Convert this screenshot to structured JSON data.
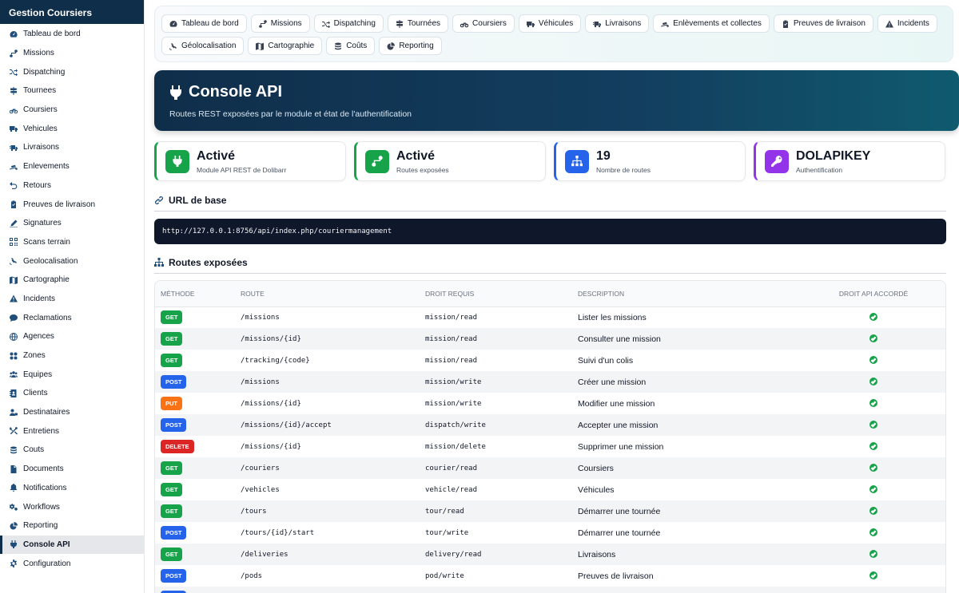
{
  "sidebar": {
    "title": "Gestion Coursiers",
    "items": [
      {
        "label": "Tableau de bord",
        "icon": "dashboard-icon"
      },
      {
        "label": "Missions",
        "icon": "route-icon"
      },
      {
        "label": "Dispatching",
        "icon": "shuffle-icon"
      },
      {
        "label": "Tournees",
        "icon": "signpost-icon"
      },
      {
        "label": "Coursiers",
        "icon": "bicycle-icon"
      },
      {
        "label": "Vehicules",
        "icon": "truck-icon"
      },
      {
        "label": "Livraisons",
        "icon": "truck-fast-icon"
      },
      {
        "label": "Enlevements",
        "icon": "dolly-icon"
      },
      {
        "label": "Retours",
        "icon": "undo-icon"
      },
      {
        "label": "Preuves de livraison",
        "icon": "clipboard-check-icon"
      },
      {
        "label": "Signatures",
        "icon": "signature-icon"
      },
      {
        "label": "Scans terrain",
        "icon": "qrcode-icon"
      },
      {
        "label": "Geolocalisation",
        "icon": "satellite-icon"
      },
      {
        "label": "Cartographie",
        "icon": "map-icon"
      },
      {
        "label": "Incidents",
        "icon": "warning-icon"
      },
      {
        "label": "Reclamations",
        "icon": "comment-icon"
      },
      {
        "label": "Agences",
        "icon": "globe-icon"
      },
      {
        "label": "Zones",
        "icon": "zones-icon"
      },
      {
        "label": "Equipes",
        "icon": "users-icon"
      },
      {
        "label": "Clients",
        "icon": "address-book-icon"
      },
      {
        "label": "Destinataires",
        "icon": "user-tag-icon"
      },
      {
        "label": "Entretiens",
        "icon": "tools-icon"
      },
      {
        "label": "Couts",
        "icon": "coins-icon"
      },
      {
        "label": "Documents",
        "icon": "file-icon"
      },
      {
        "label": "Notifications",
        "icon": "bell-icon"
      },
      {
        "label": "Workflows",
        "icon": "cogs-icon"
      },
      {
        "label": "Reporting",
        "icon": "chart-pie-icon"
      },
      {
        "label": "Console API",
        "icon": "plug-icon",
        "active": true
      },
      {
        "label": "Configuration",
        "icon": "gear-icon"
      }
    ]
  },
  "navbar": {
    "row1": [
      {
        "label": "Tableau de bord",
        "icon": "dashboard-icon"
      },
      {
        "label": "Missions",
        "icon": "route-icon"
      },
      {
        "label": "Dispatching",
        "icon": "shuffle-icon"
      },
      {
        "label": "Tournées",
        "icon": "signpost-icon"
      },
      {
        "label": "Coursiers",
        "icon": "bicycle-icon"
      },
      {
        "label": "Véhicules",
        "icon": "truck-icon"
      },
      {
        "label": "Livraisons",
        "icon": "truck-fast-icon"
      },
      {
        "label": "Enlèvements et collectes",
        "icon": "dolly-icon"
      },
      {
        "label": "Preuves de livraison",
        "icon": "clipboard-check-icon"
      },
      {
        "label": "Incidents",
        "icon": "warning-icon"
      }
    ],
    "row2": [
      {
        "label": "Géolocalisation",
        "icon": "satellite-icon"
      },
      {
        "label": "Cartographie",
        "icon": "map-icon"
      },
      {
        "label": "Coûts",
        "icon": "coins-icon"
      },
      {
        "label": "Reporting",
        "icon": "chart-pie-icon"
      }
    ]
  },
  "header": {
    "title": "Console API",
    "subtitle": "Routes REST exposées par le module et état de l'authentification"
  },
  "stats": [
    {
      "value": "Activé",
      "label": "Module API REST de Dolibarr",
      "color": "#16a34a",
      "icon": "plug-icon"
    },
    {
      "value": "Activé",
      "label": "Routes exposées",
      "color": "#16a34a",
      "icon": "route-icon"
    },
    {
      "value": "19",
      "label": "Nombre de routes",
      "color": "#2563eb",
      "icon": "sitemap-icon"
    },
    {
      "value": "DOLAPIKEY",
      "label": "Authentification",
      "color": "#9333ea",
      "icon": "key-icon"
    }
  ],
  "base_url": {
    "title": "URL de base",
    "value": "http://127.0.0.1:8756/api/index.php/couriermanagement"
  },
  "routes": {
    "title": "Routes exposées",
    "columns": [
      "Méthode",
      "Route",
      "Droit requis",
      "Description",
      "Droit API accordé"
    ],
    "rows": [
      {
        "method": "GET",
        "route": "/missions",
        "right": "mission/read",
        "description": "Lister les missions",
        "granted": true
      },
      {
        "method": "GET",
        "route": "/missions/{id}",
        "right": "mission/read",
        "description": "Consulter une mission",
        "granted": true
      },
      {
        "method": "GET",
        "route": "/tracking/{code}",
        "right": "mission/read",
        "description": "Suivi d'un colis",
        "granted": true
      },
      {
        "method": "POST",
        "route": "/missions",
        "right": "mission/write",
        "description": "Créer une mission",
        "granted": true
      },
      {
        "method": "PUT",
        "route": "/missions/{id}",
        "right": "mission/write",
        "description": "Modifier une mission",
        "granted": true
      },
      {
        "method": "POST",
        "route": "/missions/{id}/accept",
        "right": "dispatch/write",
        "description": "Accepter une mission",
        "granted": true
      },
      {
        "method": "DELETE",
        "route": "/missions/{id}",
        "right": "mission/delete",
        "description": "Supprimer une mission",
        "granted": true
      },
      {
        "method": "GET",
        "route": "/couriers",
        "right": "courier/read",
        "description": "Coursiers",
        "granted": true
      },
      {
        "method": "GET",
        "route": "/vehicles",
        "right": "vehicle/read",
        "description": "Véhicules",
        "granted": true
      },
      {
        "method": "GET",
        "route": "/tours",
        "right": "tour/read",
        "description": "Démarrer une tournée",
        "granted": true
      },
      {
        "method": "POST",
        "route": "/tours/{id}/start",
        "right": "tour/write",
        "description": "Démarrer une tournée",
        "granted": true
      },
      {
        "method": "GET",
        "route": "/deliveries",
        "right": "delivery/read",
        "description": "Livraisons",
        "granted": true
      },
      {
        "method": "POST",
        "route": "/pods",
        "right": "pod/write",
        "description": "Preuves de livraison",
        "granted": true
      },
      {
        "method": "POST",
        "route": "",
        "right": "",
        "description": "",
        "granted": true
      }
    ]
  }
}
